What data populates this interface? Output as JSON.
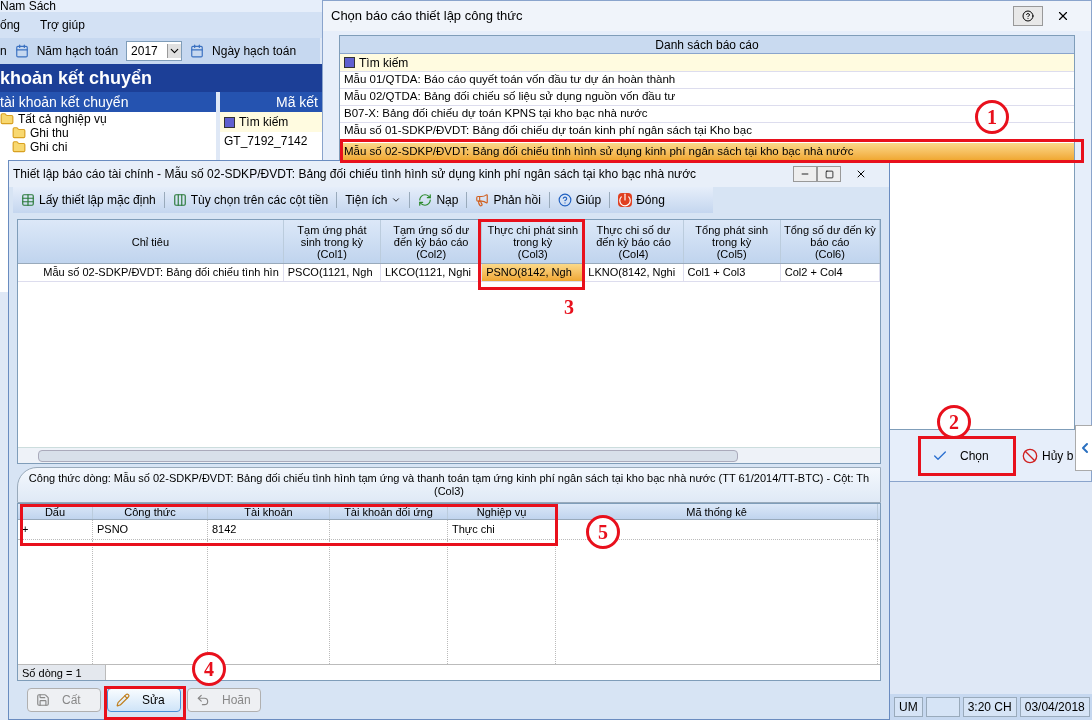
{
  "background_app": {
    "title": "Nam Sách",
    "menu": [
      "ống",
      "Trợ giúp"
    ],
    "toolbar": {
      "cut_label": "n",
      "year_label": "Năm hạch toán",
      "year_value": "2017",
      "date_label": "Ngày hạch toán"
    },
    "module_title": "khoản kết chuyển",
    "tree_panel": {
      "header": "tài khoản kết chuyển",
      "items": [
        {
          "label": "Tất cả nghiệp vụ",
          "children": [
            {
              "label": "Ghi thu"
            },
            {
              "label": "Ghi chi"
            }
          ]
        }
      ]
    },
    "code_panel": {
      "header": "Mã kết",
      "search_label": "Tìm kiếm",
      "rows": [
        "GT_7192_7142"
      ]
    },
    "status_bar": [
      "UM",
      "3:20 CH",
      "03/04/2018"
    ]
  },
  "report_picker": {
    "title": "Chọn báo cáo thiết lập công thức",
    "list_header": "Danh sách báo cáo",
    "search_label": "Tìm kiếm",
    "items": [
      {
        "label": "Mẫu 01/QTDA: Báo cáo quyết toán vốn đầu tư dự án hoàn thành",
        "selected": false
      },
      {
        "label": "Mẫu 02/QTDA: Bảng đối chiếu số liệu sử dụng nguồn vốn đầu tư",
        "selected": false
      },
      {
        "label": "B07-X: Bảng đối chiếu dự toán KPNS tại kho bạc nhà nước",
        "selected": false
      },
      {
        "label": "Mẫu số 01-SDKP/ĐVDT: Bảng đối chiếu dự toán kinh phí ngân sách tại Kho bạc",
        "selected": false
      },
      {
        "label": "Mẫu số 02-SDKP/ĐVDT: Bảng đối chiếu tình hình sử dụng kinh phí ngân sách tại kho bạc nhà nước",
        "selected": true
      }
    ],
    "buttons": [
      {
        "label": "Chọn",
        "kind": "ok"
      },
      {
        "label": "Hủy b",
        "kind": "cancel"
      }
    ]
  },
  "setup_dialog": {
    "title": "Thiết lập báo cáo tài chính - Mẫu số 02-SDKP/ĐVDT: Bảng đối chiếu tình hình sử dụng kinh phí ngân sách tại kho bạc nhà nước",
    "toolbar": [
      {
        "label": "Lấy thiết lập mặc định",
        "kind": "default"
      },
      {
        "label": "Tùy chọn trên các cột tiền",
        "kind": "options"
      },
      {
        "label": "Tiện ích",
        "kind": "menu"
      },
      {
        "label": "Nạp",
        "kind": "reload"
      },
      {
        "label": "Phản hồi",
        "kind": "feedback"
      },
      {
        "label": "Giúp",
        "kind": "help"
      },
      {
        "label": "Đóng",
        "kind": "close"
      }
    ],
    "columns": [
      {
        "label": "Chỉ tiêu"
      },
      {
        "label": "Tạm ứng phát sinh trong kỳ",
        "code": "(Col1)"
      },
      {
        "label": "Tạm ứng số dư đến kỳ báo cáo",
        "code": "(Col2)"
      },
      {
        "label": "Thực chi phát sinh trong kỳ",
        "code": "(Col3)"
      },
      {
        "label": "Thực chi số dư đến kỳ báo cáo",
        "code": "(Col4)"
      },
      {
        "label": "Tổng phát sinh trong kỳ",
        "code": "(Col5)"
      },
      {
        "label": "Tổng số dư đến kỳ báo cáo",
        "code": "(Col6)"
      }
    ],
    "rows": [
      {
        "cells": [
          {
            "text": "Mẫu số 02-SDKP/ĐVDT: Bảng đối chiếu tình hìn",
            "selected": false
          },
          {
            "text": "PSCO(1121, Ngh",
            "selected": false
          },
          {
            "text": "LKCO(1121, Nghi",
            "selected": false
          },
          {
            "text": "PSNO(8142, Ngh",
            "selected": true
          },
          {
            "text": "LKNO(8142, Nghi",
            "selected": false
          },
          {
            "text": "Col1 + Col3",
            "selected": false
          },
          {
            "text": "Col2 + Col4",
            "selected": false
          }
        ]
      }
    ],
    "formula_caption": [
      "Công thức dòng: Mẫu số 02-SDKP/ĐVDT: Bảng đối chiếu tình hình tạm ứng và thanh toán tạm ứng kinh phí ngân sách tại kho bạc nhà nước (TT 61/2014/TT-BTC) - Cột: Th",
      "(Col3)"
    ],
    "formula_columns": [
      "Dấu",
      "Công thức",
      "Tài khoản",
      "Tài khoản đối ứng",
      "Nghiệp vụ",
      "Mã thống kê"
    ],
    "formula_rows": [
      {
        "cells": [
          {
            "text": "+"
          },
          {
            "text": "PSNO"
          },
          {
            "text": "8142"
          },
          {},
          {
            "text": "Thực chi"
          },
          {}
        ]
      }
    ],
    "row_count": "Số dòng = 1",
    "buttons": [
      {
        "label": "Cất",
        "kind": "save",
        "disabled": true
      },
      {
        "label": "Sửa",
        "kind": "edit",
        "disabled": false
      },
      {
        "label": "Hoãn",
        "kind": "undo",
        "disabled": true
      }
    ]
  },
  "annotations": [
    {
      "label": "1",
      "kind": "circle"
    },
    {
      "label": "2",
      "kind": "circle"
    },
    {
      "label": "3",
      "kind": "plain"
    },
    {
      "label": "4",
      "kind": "circle"
    },
    {
      "label": "5",
      "kind": "circle"
    }
  ]
}
